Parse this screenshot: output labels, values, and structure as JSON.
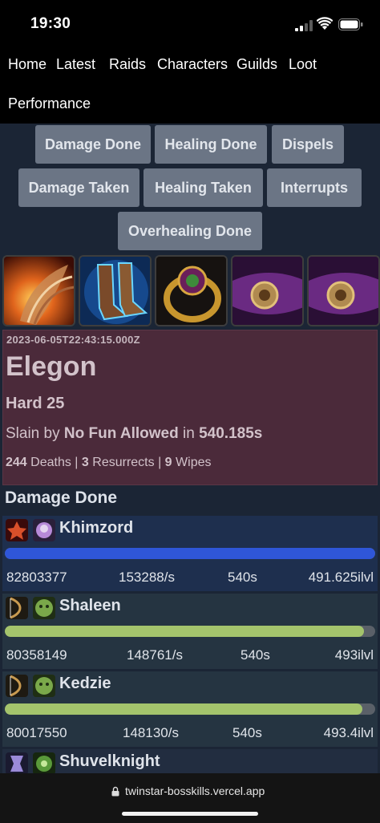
{
  "status_bar": {
    "time": "19:30"
  },
  "nav": {
    "items": [
      "Home",
      "Latest",
      "Raids",
      "Characters",
      "Guilds",
      "Loot",
      "Performance"
    ]
  },
  "tabs": [
    "Damage Done",
    "Healing Done",
    "Dispels",
    "Damage Taken",
    "Healing Taken",
    "Interrupts",
    "Overhealing Done"
  ],
  "loot_icons": [
    "feathered-wing-item-icon",
    "glowing-boots-item-icon",
    "jeweled-ring-item-icon",
    "purple-belt-item-icon",
    "purple-belt-item-icon"
  ],
  "encounter": {
    "date": "2023-06-05T22:43:15.000Z",
    "boss": "Elegon",
    "difficulty": "Hard 25",
    "slain_prefix": "Slain by",
    "guild": "No Fun Allowed",
    "slain_in": "in",
    "duration": "540.185s",
    "deaths": "244",
    "deaths_label": "Deaths |",
    "resurrects": "3",
    "resurrects_label": "Resurrects |",
    "wipes": "9",
    "wipes_label": "Wipes"
  },
  "section_title": "Damage Done",
  "players": [
    {
      "name": "Khimzord",
      "total": "82803377",
      "dps": "153288/s",
      "time": "540s",
      "ilvl": "491.625ilvl",
      "fill": 1.0,
      "bar_color": "#2f56d8",
      "class_icon": "warlock-class-icon",
      "spec_icon": "affliction-spec-icon"
    },
    {
      "name": "Shaleen",
      "total": "80358149",
      "dps": "148761/s",
      "time": "540s",
      "ilvl": "493ilvl",
      "fill": 0.97,
      "bar_color": "#a4c46c",
      "class_icon": "hunter-class-icon",
      "spec_icon": "beast-spec-icon"
    },
    {
      "name": "Kedzie",
      "total": "80017550",
      "dps": "148130/s",
      "time": "540s",
      "ilvl": "493.4ilvl",
      "fill": 0.966,
      "bar_color": "#a4c46c",
      "class_icon": "hunter-class-icon",
      "spec_icon": "beast-spec-icon"
    },
    {
      "name": "Shuvelknight",
      "class_icon": "death-knight-class-icon",
      "spec_icon": "unholy-spec-icon"
    }
  ],
  "url_bar": {
    "url": "twinstar-bosskills.vercel.app"
  }
}
